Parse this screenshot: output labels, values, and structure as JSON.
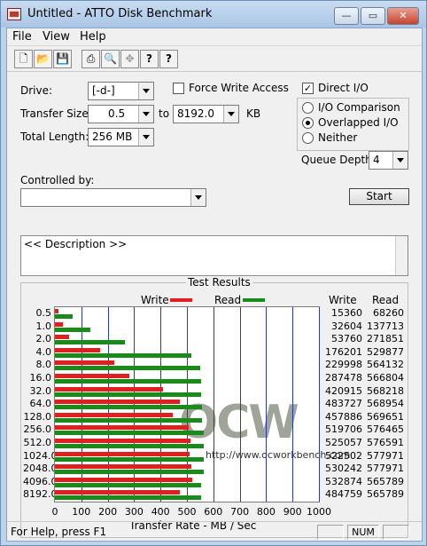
{
  "window": {
    "title": "Untitled - ATTO Disk Benchmark",
    "minimize_label": "—",
    "maximize_label": "▭",
    "close_label": "✕"
  },
  "menu": {
    "items": [
      {
        "label": "File"
      },
      {
        "label": "View"
      },
      {
        "label": "Help"
      }
    ]
  },
  "toolbar": {
    "buttons": [
      {
        "icon": "new-file-icon",
        "glyph": "🗋"
      },
      {
        "icon": "open-folder-icon",
        "glyph": "📂"
      },
      {
        "icon": "save-icon",
        "glyph": "💾"
      },
      {
        "icon": "print-icon",
        "glyph": "⎙"
      },
      {
        "icon": "print-preview-icon",
        "glyph": "🔍"
      },
      {
        "icon": "move-icon",
        "glyph": "✥"
      },
      {
        "icon": "help-icon",
        "glyph": "?"
      },
      {
        "icon": "context-help-icon",
        "glyph": "?"
      }
    ]
  },
  "settings": {
    "drive_label": "Drive:",
    "drive_value": "[-d-]",
    "force_write_label": "Force Write Access",
    "force_write_checked": false,
    "direct_io_label": "Direct I/O",
    "direct_io_checked": true,
    "transfer_size_label": "Transfer Size:",
    "transfer_from": "0.5",
    "to_label": "to",
    "transfer_to": "8192.0",
    "kb_label": "KB",
    "total_length_label": "Total Length:",
    "total_length": "256 MB",
    "io_options": [
      {
        "label": "I/O Comparison",
        "selected": false
      },
      {
        "label": "Overlapped I/O",
        "selected": true
      },
      {
        "label": "Neither",
        "selected": false
      }
    ],
    "queue_depth_label": "Queue Depth:",
    "queue_depth": "4",
    "controlled_by_label": "Controlled by:",
    "controlled_by_value": "",
    "start_label": "Start",
    "description_text": "<< Description >>"
  },
  "results": {
    "title": "Test Results",
    "write_legend": "Write",
    "read_legend": "Read",
    "write_col": "Write",
    "read_col": "Read",
    "write_color": "#e02020",
    "read_color": "#1a8a1a",
    "watermark_logo": "OCW",
    "watermark_url": "http://www.ocworkbench.com"
  },
  "chart_data": {
    "type": "bar",
    "title": "Test Results",
    "xlabel": "Transfer Rate - MB / Sec",
    "ylabel": "",
    "xlim": [
      0,
      1000
    ],
    "x_ticks": [
      "0",
      "100",
      "200",
      "300",
      "400",
      "500",
      "600",
      "700",
      "800",
      "900",
      "1000"
    ],
    "categories": [
      "0.5",
      "1.0",
      "2.0",
      "4.0",
      "8.0",
      "16.0",
      "32.0",
      "64.0",
      "128.0",
      "256.0",
      "512.0",
      "1024.0",
      "2048.0",
      "4096.0",
      "8192.0"
    ],
    "series": [
      {
        "name": "Write",
        "values_kb": [
          15360,
          32604,
          53760,
          176201,
          229998,
          287478,
          420915,
          483727,
          457886,
          519706,
          525057,
          522502,
          530242,
          532874,
          484759
        ]
      },
      {
        "name": "Read",
        "values_kb": [
          68260,
          137713,
          271851,
          529877,
          564132,
          566804,
          568218,
          568954,
          569651,
          576465,
          576591,
          577971,
          577971,
          565789,
          565789
        ]
      }
    ],
    "legend": "top",
    "grid": true
  },
  "status": {
    "text": "For Help, press F1",
    "num_label": "NUM"
  }
}
